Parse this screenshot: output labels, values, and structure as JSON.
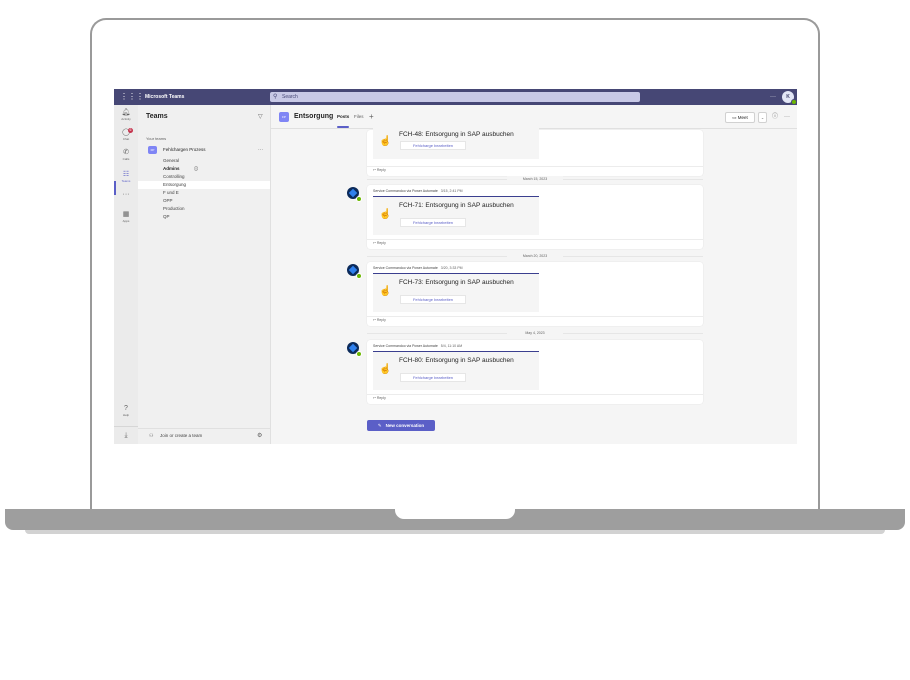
{
  "topbar": {
    "app_name": "Microsoft Teams",
    "search_placeholder": "Search",
    "more": "···",
    "avatar_initials": "K"
  },
  "rail": [
    {
      "label": "Activity",
      "icon": "bell-icon",
      "glyph": "🔔︎"
    },
    {
      "label": "Chat",
      "icon": "chat-icon",
      "glyph": "◯",
      "badge": "6"
    },
    {
      "label": "Calls",
      "icon": "phone-icon",
      "glyph": "✆"
    },
    {
      "label": "Teams",
      "icon": "teams-icon",
      "glyph": "☷",
      "active": true
    },
    {
      "label": "",
      "icon": "more-apps-icon",
      "glyph": "···"
    },
    {
      "label": "Apps",
      "icon": "apps-icon",
      "glyph": "▦"
    }
  ],
  "rail_help": {
    "label": "Help",
    "icon": "help-icon",
    "glyph": "?"
  },
  "teams_panel": {
    "title": "Teams",
    "your_teams": "Your teams",
    "team": {
      "avatar": "FP",
      "name": "Fehlchargen Prozess"
    },
    "channels": [
      {
        "name": "General"
      },
      {
        "name": "Admins",
        "bold": true,
        "private": true
      },
      {
        "name": "Controlling"
      },
      {
        "name": "Entsorgung",
        "selected": true
      },
      {
        "name": "F und E"
      },
      {
        "name": "OPP"
      },
      {
        "name": "Production"
      },
      {
        "name": "QP"
      }
    ],
    "join_create": "Join or create a team"
  },
  "channel_header": {
    "avatar": "FP",
    "name": "Entsorgung",
    "tabs": [
      "Posts",
      "Files"
    ],
    "meet_label": "Meet"
  },
  "posts": [
    {
      "sender": "",
      "time": "",
      "card_title": "FCH-48: Entsorgung in SAP ausbuchen",
      "card_button": "Fehlcharge bearbeiten",
      "reply": "Reply",
      "partial": true
    },
    {
      "sender": "Service Commandoo via Power Automate",
      "time": "3/15, 2:41 PM",
      "card_title": "FCH-71: Entsorgung in SAP ausbuchen",
      "card_button": "Fehlcharge bearbeiten",
      "reply": "Reply"
    },
    {
      "sender": "Service Commandoo via Power Automate",
      "time": "3/20, 3:33 PM",
      "card_title": "FCH-73: Entsorgung in SAP ausbuchen",
      "card_button": "Fehlcharge bearbeiten",
      "reply": "Reply"
    },
    {
      "sender": "Service Commandoo via Power Automate",
      "time": "5/4, 11:10 AM",
      "card_title": "FCH-80: Entsorgung in SAP ausbuchen",
      "card_button": "Fehlcharge bearbeiten",
      "reply": "Reply"
    }
  ],
  "date_separators": [
    "March 15, 2023",
    "March 20, 2023",
    "May 4, 2023"
  ],
  "new_conversation": "New conversation",
  "colors": {
    "topbar": "#464775",
    "accent": "#5b5fc7",
    "card_rule": "#3b3f8f"
  }
}
